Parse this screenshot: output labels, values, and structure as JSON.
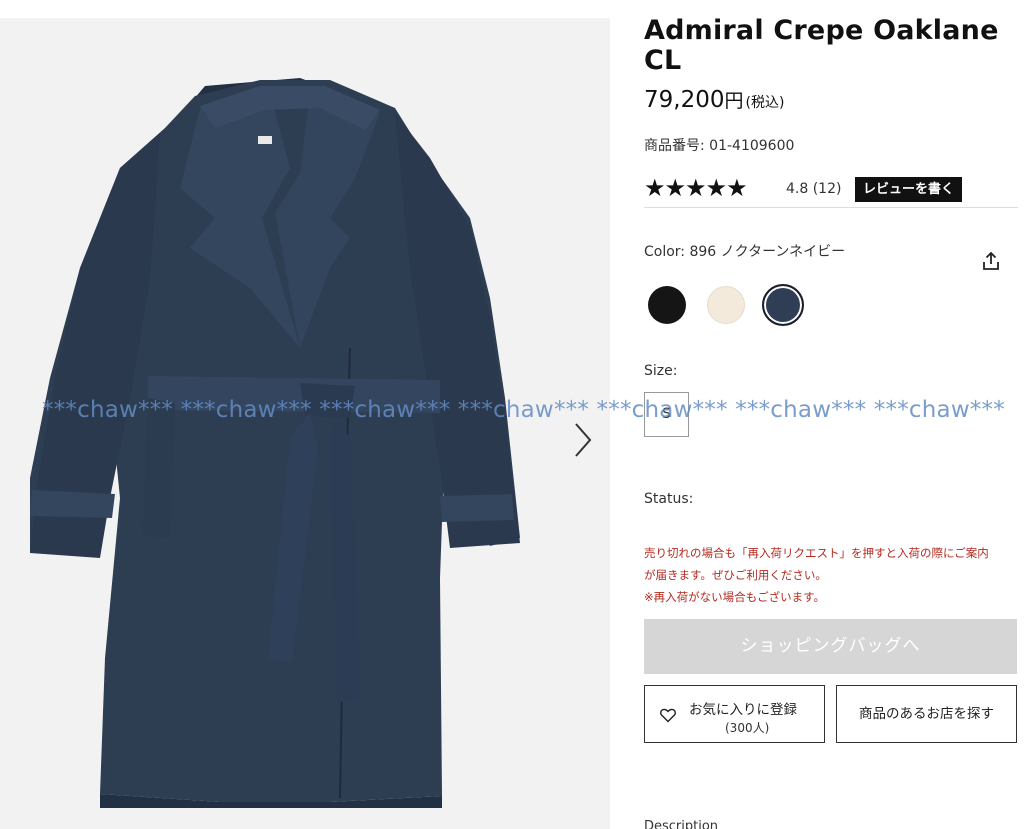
{
  "product": {
    "title": "Admiral Crepe Oaklane CL",
    "price_value": "79,200",
    "price_currency": "円",
    "price_tax": "(税込)",
    "sku": "商品番号: 01-4109600",
    "rating_stars": "★★★★★",
    "rating_text": "4.8 (12)",
    "review_button": "レビューを書く",
    "color_label": "Color:  896 ノクターンネイビー",
    "size_label": "Size:",
    "size_selected": "S",
    "status_label": "Status:",
    "notice_line1": "売り切れの場合も「再入荷リクエスト」を押すと入荷の際にご案内",
    "notice_line2": "が届きます。ぜひご利用ください。",
    "notice_line3": "※再入荷がない場合もございます。",
    "bag_button": "ショッピングバッグへ",
    "favorite_button": "お気に入りに登録",
    "favorite_count": "(300人)",
    "store_button": "商品のあるお店を探す",
    "description_label": "Description",
    "watermark": "***chaw*** ***chaw*** ***chaw*** ***chaw*** ***chaw*** ***chaw*** ***chaw***",
    "swatches": [
      {
        "name": "black",
        "color": "#151515"
      },
      {
        "name": "cream",
        "color": "#f4eadb"
      },
      {
        "name": "navy",
        "color": "#2f3e55"
      }
    ]
  },
  "colors": {
    "notice": "#b22b20",
    "bag_disabled": "#d6d6d6",
    "coat": "#2d3d52"
  },
  "icons": [
    "chevron-right-icon",
    "share-icon",
    "heart-icon",
    "star-icon"
  ]
}
